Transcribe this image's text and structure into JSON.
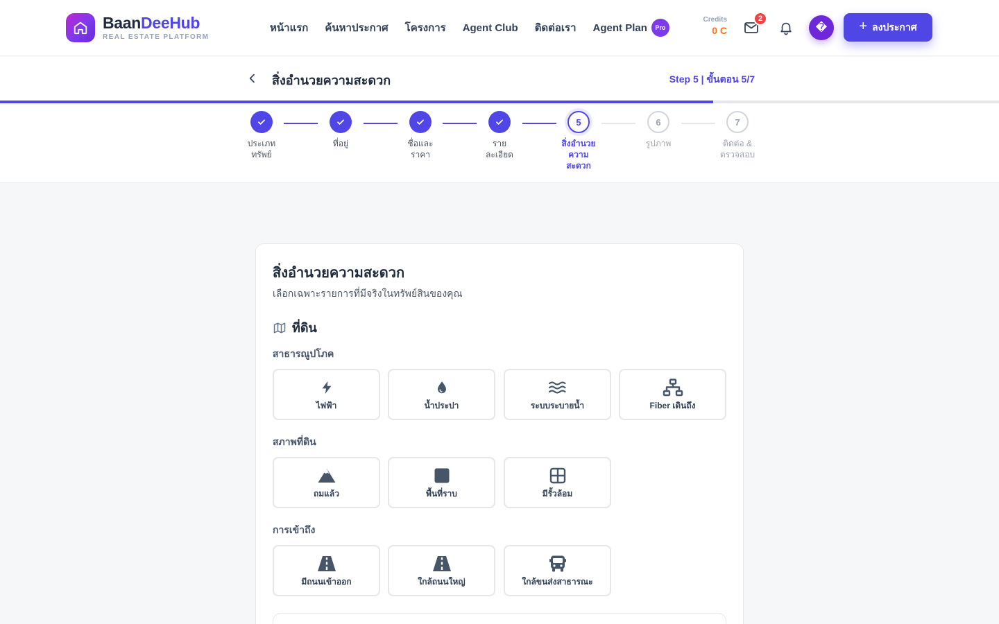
{
  "brand": {
    "name_part1": "Baan",
    "name_part2": "DeeHub",
    "tagline": "REAL ESTATE PLATFORM",
    "gradient_start": "#c026d3",
    "gradient_end": "#6d28d9"
  },
  "nav": {
    "items": [
      {
        "label": "หน้าแรก"
      },
      {
        "label": "ค้นหาประกาศ"
      },
      {
        "label": "โครงการ"
      },
      {
        "label": "Agent Club"
      },
      {
        "label": "ติดต่อเรา"
      },
      {
        "label": "Agent Plan"
      }
    ],
    "pro_badge": "Pro"
  },
  "account": {
    "credits_label": "Credits",
    "credits_value": "0 C",
    "mail_badge": "2",
    "avatar_glyph": "�",
    "post_button": "ลงประกาศ"
  },
  "wizard": {
    "title": "สิ่งอำนวยความสะดวก",
    "step_counter": "Step 5 | ขั้นตอน 5/7",
    "progress_percent": 71.4,
    "steps": [
      {
        "number": "1",
        "label": "ประเภททรัพย์",
        "status": "done"
      },
      {
        "number": "2",
        "label": "ที่อยู่",
        "status": "done"
      },
      {
        "number": "3",
        "label": "ชื่อและราคา",
        "status": "done"
      },
      {
        "number": "4",
        "label": "รายละเอียด",
        "status": "done"
      },
      {
        "number": "5",
        "label": "สิ่งอำนวยความสะดวก",
        "status": "current"
      },
      {
        "number": "6",
        "label": "รูปภาพ",
        "status": "todo"
      },
      {
        "number": "7",
        "label": "ติดต่อ & ตรวจสอบ",
        "status": "todo"
      }
    ]
  },
  "card": {
    "title": "สิ่งอำนวยความสะดวก",
    "subtitle": "เลือกเฉพาะรายการที่มีจริงในทรัพย์สินของคุณ",
    "section": {
      "icon": "map-icon",
      "title": "ที่ดิน"
    },
    "groups": [
      {
        "label": "สาธารณูปโภค",
        "items": [
          {
            "label": "ไฟฟ้า",
            "icon": "bolt-icon"
          },
          {
            "label": "น้ำประปา",
            "icon": "water-drop-icon"
          },
          {
            "label": "ระบบระบายน้ำ",
            "icon": "water-waves-icon"
          },
          {
            "label": "Fiber เดินถึง",
            "icon": "network-icon"
          }
        ]
      },
      {
        "label": "สภาพที่ดิน",
        "items": [
          {
            "label": "ถมแล้ว",
            "icon": "mountain-icon"
          },
          {
            "label": "พื้นที่ราบ",
            "icon": "square-icon"
          },
          {
            "label": "มีรั้วล้อม",
            "icon": "grid-fence-icon"
          }
        ]
      },
      {
        "label": "การเข้าถึง",
        "items": [
          {
            "label": "มีถนนเข้าออก",
            "icon": "road-icon"
          },
          {
            "label": "ใกล้ถนนใหญ่",
            "icon": "road-icon"
          },
          {
            "label": "ใกล้ขนส่งสาธารณะ",
            "icon": "bus-icon"
          }
        ]
      }
    ]
  },
  "colors": {
    "primary": "#4f46e5",
    "credits": "#f97316",
    "badge": "#ef4444",
    "icon": "#475569"
  }
}
